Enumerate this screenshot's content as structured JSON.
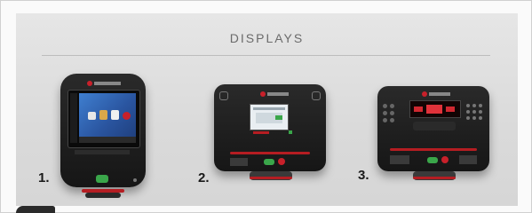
{
  "section": {
    "title": "DISPLAYS"
  },
  "displays": [
    {
      "label": "1."
    },
    {
      "label": "2."
    },
    {
      "label": "3."
    }
  ],
  "colors": {
    "panel_bg": "#dadada",
    "console_body": "#1f1f1f",
    "accent_red": "#b51d22",
    "screen_blue": "#2f5fae",
    "green_button": "#3aa64a"
  }
}
